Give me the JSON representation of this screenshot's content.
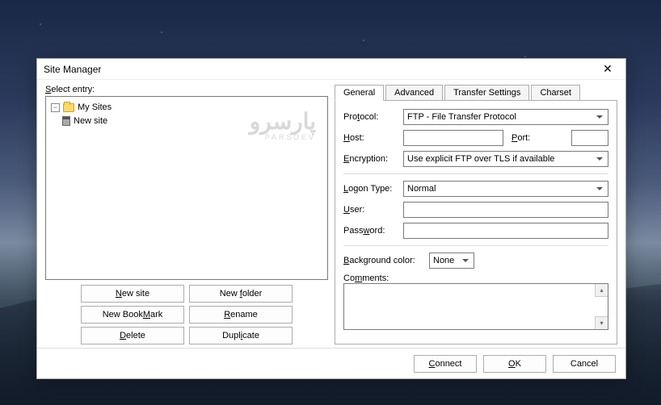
{
  "window": {
    "title": "Site Manager"
  },
  "left": {
    "label": "Select entry:",
    "tree": {
      "root": "My Sites",
      "child": "New site"
    },
    "watermark_big": "پارسرو",
    "watermark_small": "PARSDEV",
    "buttons": {
      "new_site": "New site",
      "new_folder": "New folder",
      "new_bookmark": "New Bookmark",
      "rename": "Rename",
      "delete": "Delete",
      "duplicate": "Duplicate"
    }
  },
  "tabs": [
    "General",
    "Advanced",
    "Transfer Settings",
    "Charset"
  ],
  "form": {
    "protocol_label": "Protocol:",
    "protocol_value": "FTP - File Transfer Protocol",
    "host_label": "Host:",
    "host_value": "",
    "port_label": "Port:",
    "port_value": "",
    "encryption_label": "Encryption:",
    "encryption_value": "Use explicit FTP over TLS if available",
    "logon_label": "Logon Type:",
    "logon_value": "Normal",
    "user_label": "User:",
    "user_value": "",
    "password_label": "Password:",
    "password_value": "",
    "bgcolor_label": "Background color:",
    "bgcolor_value": "None",
    "comments_label": "Comments:",
    "comments_value": ""
  },
  "footer": {
    "connect": "Connect",
    "ok": "OK",
    "cancel": "Cancel"
  }
}
